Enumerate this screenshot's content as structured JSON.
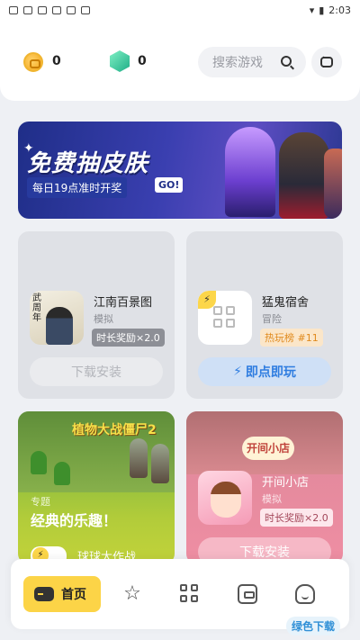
{
  "status_bar": {
    "time": "2:03"
  },
  "header": {
    "coins": "0",
    "gems": "0",
    "search_placeholder": "搜索游戏"
  },
  "banner": {
    "title": "免费抽皮肤",
    "subtitle": "每日19点准时开奖",
    "go_label": "GO!"
  },
  "games": [
    {
      "name": "江南百景图",
      "tag": "模拟",
      "reward": "时长奖励×2.0",
      "action": "下载安装",
      "icon_text": "武周年"
    },
    {
      "name": "猛鬼宿舍",
      "tag": "冒险",
      "reward": "热玩榜 #11",
      "action": "即点即玩"
    },
    {
      "section": "专题",
      "title": "经典的乐趣！",
      "name": "球球大作战",
      "logo": "植物大战僵尸2"
    },
    {
      "name": "开间小店",
      "tag": "模拟",
      "reward": "时长奖励×2.0",
      "action": "下载安装",
      "logo": "开间小店"
    }
  ],
  "nav": {
    "home_label": "首页"
  },
  "watermark": "绿色下载",
  "colors": {
    "accent": "#fcd447",
    "play_blue": "#2f7de0",
    "hot_orange": "#e08a1d"
  }
}
